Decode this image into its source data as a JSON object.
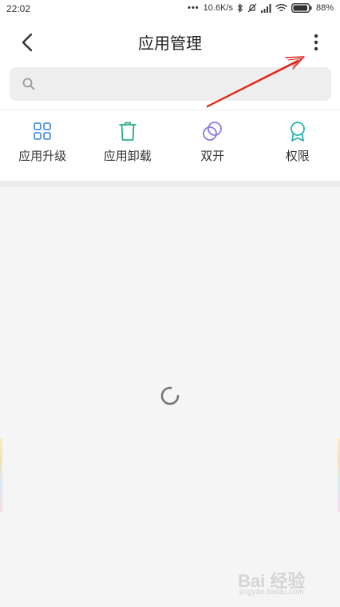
{
  "status_bar": {
    "time": "22:02",
    "dots": "•••",
    "speed": "10.6K/s",
    "battery_percent": "88%"
  },
  "header": {
    "title": "应用管理"
  },
  "search": {
    "placeholder": ""
  },
  "actions": [
    {
      "label": "应用升级",
      "icon": "grid-icon",
      "color": "#4a90e2"
    },
    {
      "label": "应用卸载",
      "icon": "trash-icon",
      "color": "#2bb08a"
    },
    {
      "label": "双开",
      "icon": "dual-circle-icon",
      "color": "#8a7be0"
    },
    {
      "label": "权限",
      "icon": "badge-icon",
      "color": "#1fb3b0"
    }
  ],
  "colors": {
    "annotation_arrow": "#e0261c",
    "background": "#f5f5f5"
  },
  "watermark": {
    "brand": "Bai 经验",
    "url": "jingyan.baidu.com"
  }
}
